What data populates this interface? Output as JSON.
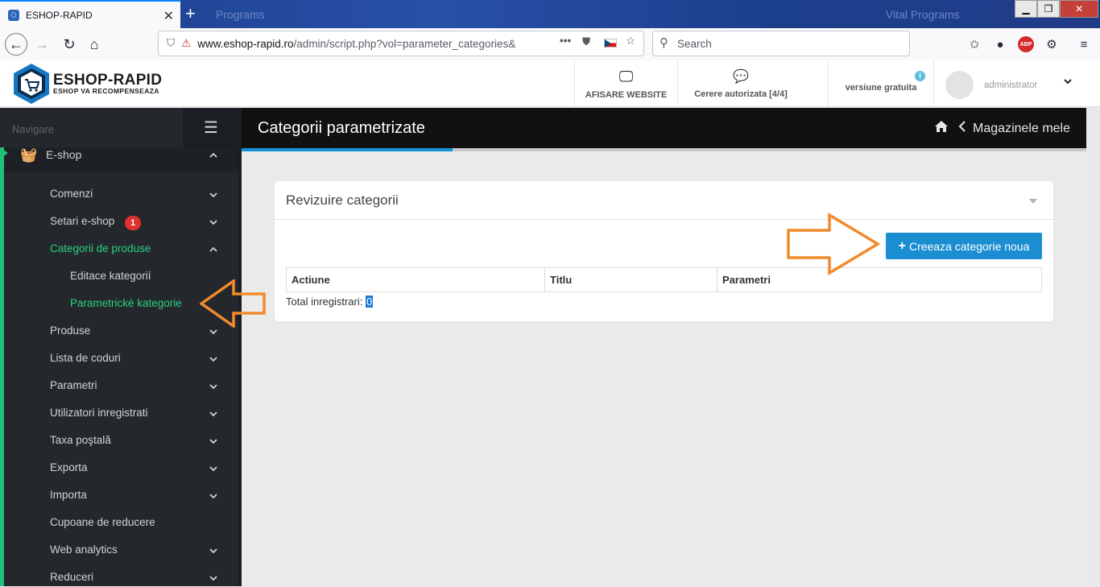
{
  "browser": {
    "tab_title": "ESHOP-RAPID",
    "url_host": "www.eshop-rapid.ro",
    "url_path": "/admin/script.php?vol=parameter_categories&",
    "search_placeholder": "Search",
    "bg_tab_texts": [
      "Programs",
      "Vital Programs"
    ]
  },
  "header": {
    "logo_title": "ESHOP-RAPID",
    "logo_subtitle": "ESHOP VA RECOMPENSEAZA",
    "view_website": "AFISARE WEBSITE",
    "requests": "Cerere autorizata [4/4]",
    "version": "versiune gratuita",
    "user": "administrator"
  },
  "sidebar": {
    "heading": "Navigare",
    "section": "E-shop",
    "items": [
      {
        "label": "Comenzi",
        "state": "collapsed"
      },
      {
        "label": "Setari e-shop",
        "state": "collapsed",
        "badge": "1"
      },
      {
        "label": "Categorii de produse",
        "state": "expanded",
        "active": true
      },
      {
        "label": "Produse",
        "state": "collapsed"
      },
      {
        "label": "Lista de coduri",
        "state": "collapsed"
      },
      {
        "label": "Parametri",
        "state": "collapsed"
      },
      {
        "label": "Utilizatori inregistrati",
        "state": "collapsed"
      },
      {
        "label": "Taxa poştală",
        "state": "collapsed"
      },
      {
        "label": "Exporta",
        "state": "collapsed"
      },
      {
        "label": "Importa",
        "state": "collapsed"
      },
      {
        "label": "Cupoane de reducere",
        "state": "none"
      },
      {
        "label": "Web analytics",
        "state": "collapsed"
      },
      {
        "label": "Reduceri",
        "state": "collapsed"
      }
    ],
    "subitems": [
      {
        "label": "Editace kategorií"
      },
      {
        "label": "Parametrické kategorie",
        "active": true
      }
    ]
  },
  "page": {
    "title": "Categorii parametrizate",
    "breadcrumb": "Magazinele mele",
    "progress": 0.25
  },
  "card": {
    "title": "Revizuire categorii",
    "create_button": "Creeaza categorie noua",
    "columns": [
      "Actiune",
      "Titlu",
      "Parametri"
    ],
    "total_label": "Total inregistrari:",
    "total_value": "0"
  },
  "colors": {
    "accent_green": "#27d07f",
    "accent_blue": "#1a8ed1",
    "annotation_orange": "#f28a2b",
    "badge_red": "#e0312f"
  }
}
